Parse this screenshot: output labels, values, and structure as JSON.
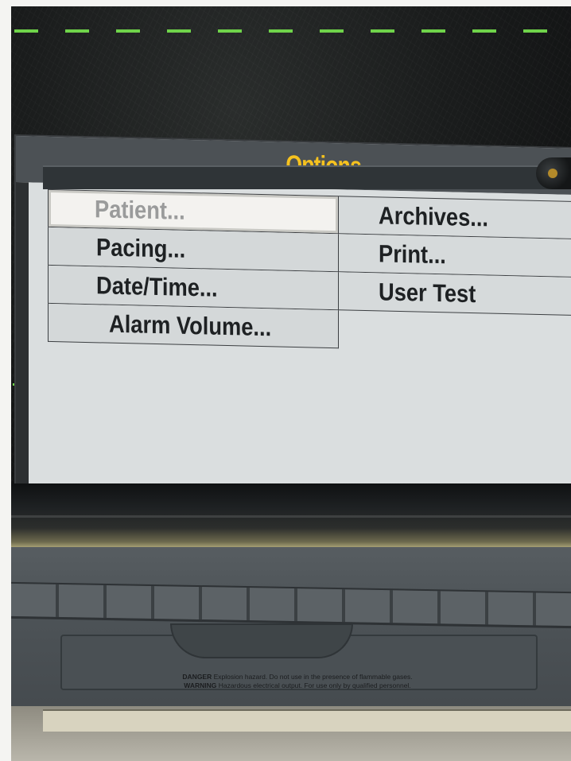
{
  "dialog": {
    "title": "Options",
    "left_items": [
      {
        "label": "Patient...",
        "selected": true
      },
      {
        "label": "Pacing..."
      },
      {
        "label": "Date/Time..."
      },
      {
        "label": "Alarm Volume..."
      }
    ],
    "right_items": [
      {
        "label": "Archives..."
      },
      {
        "label": "Print..."
      },
      {
        "label": "User Test"
      }
    ]
  },
  "warning_label": {
    "line1_prefix": "DANGER",
    "line1": "Explosion hazard. Do not use in the presence of flammable gases.",
    "line2_prefix": "WARNING",
    "line2": "Hazardous electrical output. For use only by qualified personnel."
  },
  "colors": {
    "title": "#f6c21f",
    "trace": "#6fd34a",
    "selected_bg": "#f3f2ef",
    "dialog_bg": "#dadedf",
    "titlebar_bg": "#4c5155"
  }
}
